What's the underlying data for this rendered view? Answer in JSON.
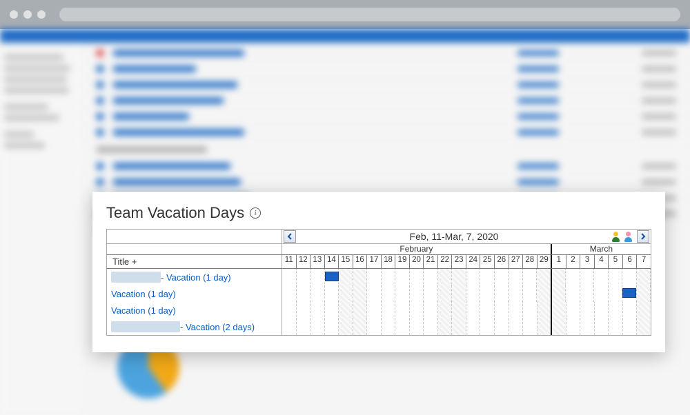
{
  "card": {
    "title": "Team Vacation Days",
    "date_range": "Feb, 11-Mar, 7, 2020",
    "months": [
      "February",
      "March"
    ],
    "title_header": "Title +",
    "days": [
      {
        "n": "11",
        "weekend": false
      },
      {
        "n": "12",
        "weekend": false
      },
      {
        "n": "13",
        "weekend": false
      },
      {
        "n": "14",
        "weekend": false
      },
      {
        "n": "15",
        "weekend": true
      },
      {
        "n": "16",
        "weekend": true
      },
      {
        "n": "17",
        "weekend": false
      },
      {
        "n": "18",
        "weekend": false
      },
      {
        "n": "19",
        "weekend": false
      },
      {
        "n": "20",
        "weekend": false
      },
      {
        "n": "21",
        "weekend": false
      },
      {
        "n": "22",
        "weekend": true
      },
      {
        "n": "23",
        "weekend": true
      },
      {
        "n": "24",
        "weekend": false
      },
      {
        "n": "25",
        "weekend": false
      },
      {
        "n": "26",
        "weekend": false
      },
      {
        "n": "27",
        "weekend": false
      },
      {
        "n": "28",
        "weekend": false
      },
      {
        "n": "29",
        "weekend": true
      },
      {
        "n": "1",
        "weekend": true
      },
      {
        "n": "2",
        "weekend": false
      },
      {
        "n": "3",
        "weekend": false
      },
      {
        "n": "4",
        "weekend": false
      },
      {
        "n": "5",
        "weekend": false
      },
      {
        "n": "6",
        "weekend": false
      },
      {
        "n": "7",
        "weekend": true
      }
    ],
    "rows": [
      {
        "blob_w": 72,
        "label": " - Vacation (1 day)",
        "bar_start": 3,
        "bar_span": 1
      },
      {
        "blob_w": 0,
        "label": "Vacation (1 day)",
        "bar_start": 24,
        "bar_span": 1
      },
      {
        "blob_w": 0,
        "label": "Vacation (1 day)",
        "bar_start": null,
        "bar_span": 0
      },
      {
        "blob_w": 100,
        "label": " - Vacation (2 days)",
        "bar_start": null,
        "bar_span": 0
      }
    ]
  }
}
